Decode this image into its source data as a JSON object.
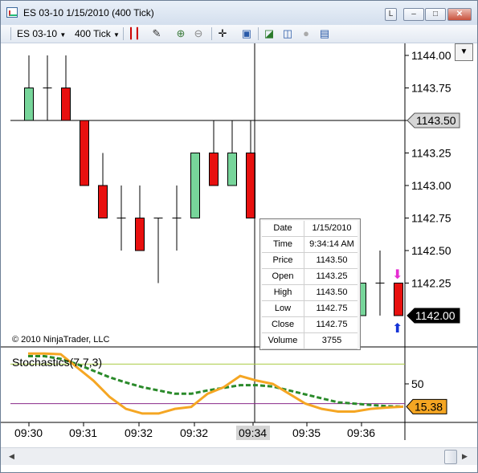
{
  "window": {
    "title": "ES 03-10  1/15/2010 (400 Tick)",
    "buttons": {
      "lock": "L",
      "minimize": "–",
      "maximize": "□",
      "close": "✕"
    }
  },
  "toolbar": {
    "instrument": "ES 03-10",
    "interval": "400 Tick"
  },
  "price_axis": {
    "ticks": [
      "1144.00",
      "1143.75",
      "1143.50",
      "1143.25",
      "1143.00",
      "1142.75",
      "1142.50",
      "1142.25"
    ],
    "horizontal_line_label": "1143.50",
    "last_price_label": "1142.00"
  },
  "copyright": "© 2010 NinjaTrader, LLC",
  "indicator": {
    "name": "Stochastics(7,7,3)",
    "axis_tick": "50",
    "value_label": "15.38"
  },
  "time_axis": {
    "labels": [
      "09:30",
      "09:31",
      "09:32",
      "09:32",
      "09:34",
      "09:35",
      "09:36"
    ],
    "highlighted": "09:34"
  },
  "data_box": {
    "rows": [
      {
        "key": "Date",
        "value": "1/15/2010"
      },
      {
        "key": "Time",
        "value": "9:34:14 AM"
      },
      {
        "key": "Price",
        "value": "1143.50"
      },
      {
        "key": "Open",
        "value": "1143.25"
      },
      {
        "key": "High",
        "value": "1143.50"
      },
      {
        "key": "Low",
        "value": "1142.75"
      },
      {
        "key": "Close",
        "value": "1142.75"
      },
      {
        "key": "Volume",
        "value": "3755"
      }
    ]
  },
  "colors": {
    "up": "#77d59a",
    "down": "#e8100f",
    "stoch_d": "#f5a623",
    "stoch_k": "#2a8a2a",
    "line_upper": "#aacc44",
    "line_lower": "#8a2a8a"
  },
  "chart_data": {
    "type": "candlestick",
    "candles": [
      {
        "open": 1143.5,
        "high": 1144.0,
        "low": 1143.5,
        "close": 1143.75
      },
      {
        "open": 1143.75,
        "high": 1144.0,
        "low": 1143.5,
        "close": 1143.75
      },
      {
        "open": 1143.75,
        "high": 1144.0,
        "low": 1143.5,
        "close": 1143.5
      },
      {
        "open": 1143.5,
        "high": 1143.5,
        "low": 1143.0,
        "close": 1143.0
      },
      {
        "open": 1143.0,
        "high": 1143.25,
        "low": 1142.75,
        "close": 1142.75
      },
      {
        "open": 1142.75,
        "high": 1143.0,
        "low": 1142.5,
        "close": 1142.75
      },
      {
        "open": 1142.75,
        "high": 1143.0,
        "low": 1142.5,
        "close": 1142.5
      },
      {
        "open": 1142.75,
        "high": 1142.75,
        "low": 1142.25,
        "close": 1142.75
      },
      {
        "open": 1142.75,
        "high": 1143.0,
        "low": 1142.5,
        "close": 1142.75
      },
      {
        "open": 1142.75,
        "high": 1143.25,
        "low": 1142.75,
        "close": 1143.25
      },
      {
        "open": 1143.25,
        "high": 1143.5,
        "low": 1143.0,
        "close": 1143.0
      },
      {
        "open": 1143.0,
        "high": 1143.5,
        "low": 1143.0,
        "close": 1143.25
      },
      {
        "open": 1143.25,
        "high": 1143.5,
        "low": 1142.75,
        "close": 1142.75
      },
      {
        "open": 1142.0,
        "high": 1142.25,
        "low": 1142.0,
        "close": 1142.25
      },
      {
        "open": 1142.25,
        "high": 1142.25,
        "low": 1142.0,
        "close": 1142.0
      },
      {
        "open": 1142.0,
        "high": 1142.25,
        "low": 1142.0,
        "close": 1142.25
      },
      {
        "open": 1142.25,
        "high": 1142.5,
        "low": 1142.0,
        "close": 1142.25
      },
      {
        "open": 1142.25,
        "high": 1142.25,
        "low": 1142.0,
        "close": 1142.0
      }
    ],
    "price_range": [
      1142.0,
      1144.0
    ],
    "horizontal_line": 1143.5,
    "stochastics": {
      "d": [
        96,
        96,
        95,
        75,
        55,
        30,
        12,
        5,
        5,
        12,
        15,
        35,
        45,
        62,
        55,
        50,
        35,
        20,
        12,
        8,
        8,
        12,
        14,
        15.38
      ],
      "k": [
        92,
        92,
        88,
        80,
        70,
        60,
        52,
        45,
        40,
        35,
        35,
        40,
        44,
        48,
        48,
        46,
        40,
        34,
        28,
        22,
        20,
        18,
        16,
        15.38
      ],
      "range": [
        0,
        100
      ],
      "upper_level": 80,
      "lower_level": 20
    }
  }
}
